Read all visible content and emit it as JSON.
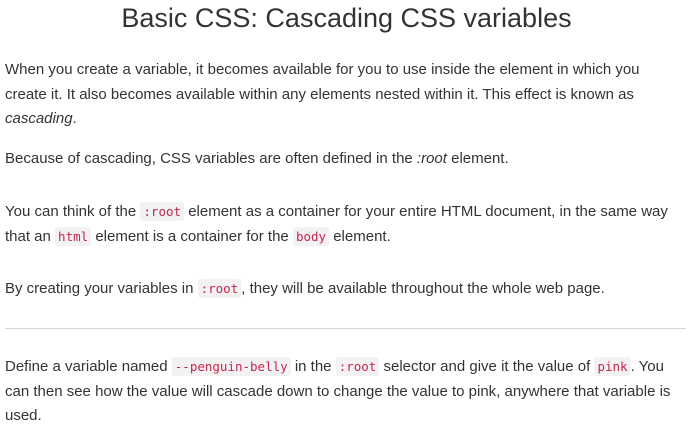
{
  "title": "Basic CSS: Cascading CSS variables",
  "p1": {
    "t1": "When you create a variable, it becomes available for you to use inside the element in which you create it. It also becomes available within any elements nested within it. This effect is known as ",
    "em": "cascading",
    "t2": "."
  },
  "p2": {
    "t1": "Because of cascading, CSS variables are often defined in the ",
    "em": ":root",
    "t2": " element."
  },
  "p3": {
    "t1": "You can think of the ",
    "c1": ":root",
    "t2": " element as a container for your entire HTML document, in the same way that an ",
    "c2": "html",
    "t3": " element is a container for the ",
    "c3": "body",
    "t4": " element."
  },
  "p4": {
    "t1": "By creating your variables in ",
    "c1": ":root",
    "t2": ", they will be available throughout the whole web page."
  },
  "p5": {
    "t1": "Define a variable named ",
    "c1": "--penguin-belly",
    "t2": " in the ",
    "c2": ":root",
    "t3": " selector and give it the value of ",
    "c3": "pink",
    "t4": ". You can then see how the value will cascade down to change the value to pink, anywhere that variable is used."
  },
  "colors": {
    "text": "#333333",
    "code_text": "#c7254e",
    "code_bg": "#f2f2f2",
    "divider": "#d6d6d6"
  }
}
